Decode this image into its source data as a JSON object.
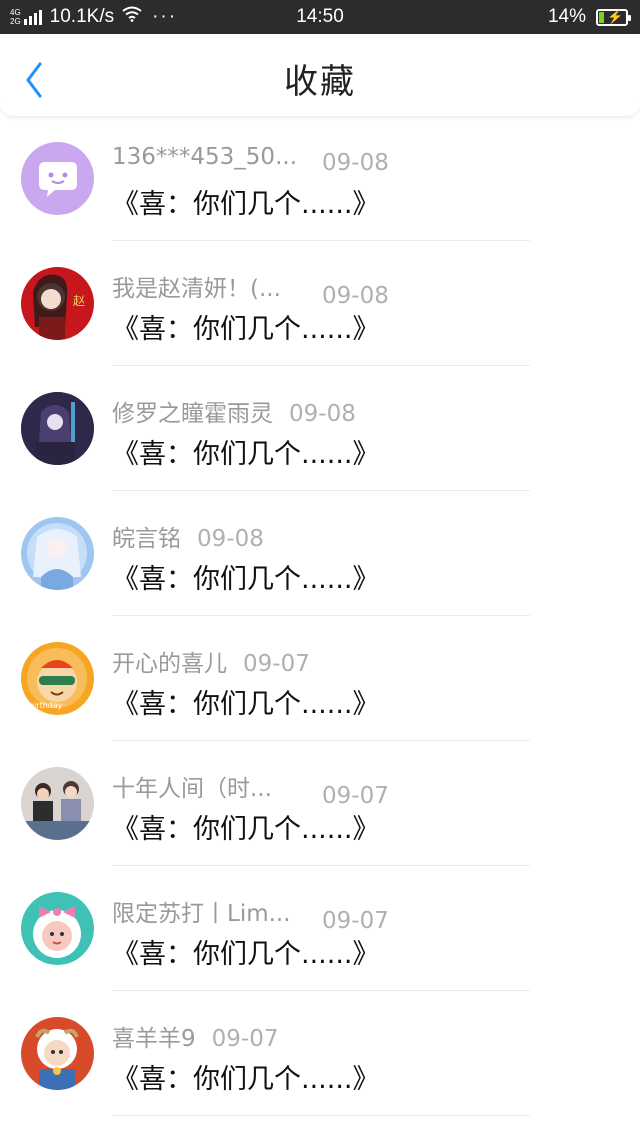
{
  "status_bar": {
    "network": "4G⁺\n2G",
    "speed": "10.1K/s",
    "dots": "···",
    "time": "14:50",
    "battery": "14%",
    "battery_color": "#7ed321"
  },
  "header": {
    "back_icon": "chevron-left-icon",
    "title": "收藏",
    "accent": "#1e90ff"
  },
  "items": [
    {
      "name": "136***453_50...",
      "date": "09-08",
      "message": "《喜：你们几个......》",
      "avatar": "chat-bubble-avatar"
    },
    {
      "name": "我是赵清妍！(...",
      "date": "09-08",
      "message": "《喜：你们几个......》",
      "avatar": "girl-red-avatar"
    },
    {
      "name": "修罗之瞳霍雨灵",
      "date": "09-08",
      "message": "《喜：你们几个......》",
      "avatar": "anime-dark-avatar"
    },
    {
      "name": "皖言铭",
      "date": "09-08",
      "message": "《喜：你们几个......》",
      "avatar": "anime-blue-avatar"
    },
    {
      "name": "开心的喜儿",
      "date": "09-07",
      "message": "《喜：你们几个......》",
      "avatar": "birthday-cartoon-avatar"
    },
    {
      "name": "十年人间（时...",
      "date": "09-07",
      "message": "《喜：你们几个......》",
      "avatar": "group-photo-avatar"
    },
    {
      "name": "限定苏打丨Lim...",
      "date": "09-07",
      "message": "《喜：你们几个......》",
      "avatar": "sheep-bow-avatar"
    },
    {
      "name": "喜羊羊9",
      "date": "09-07",
      "message": "《喜：你们几个......》",
      "avatar": "pleasant-goat-avatar"
    }
  ]
}
